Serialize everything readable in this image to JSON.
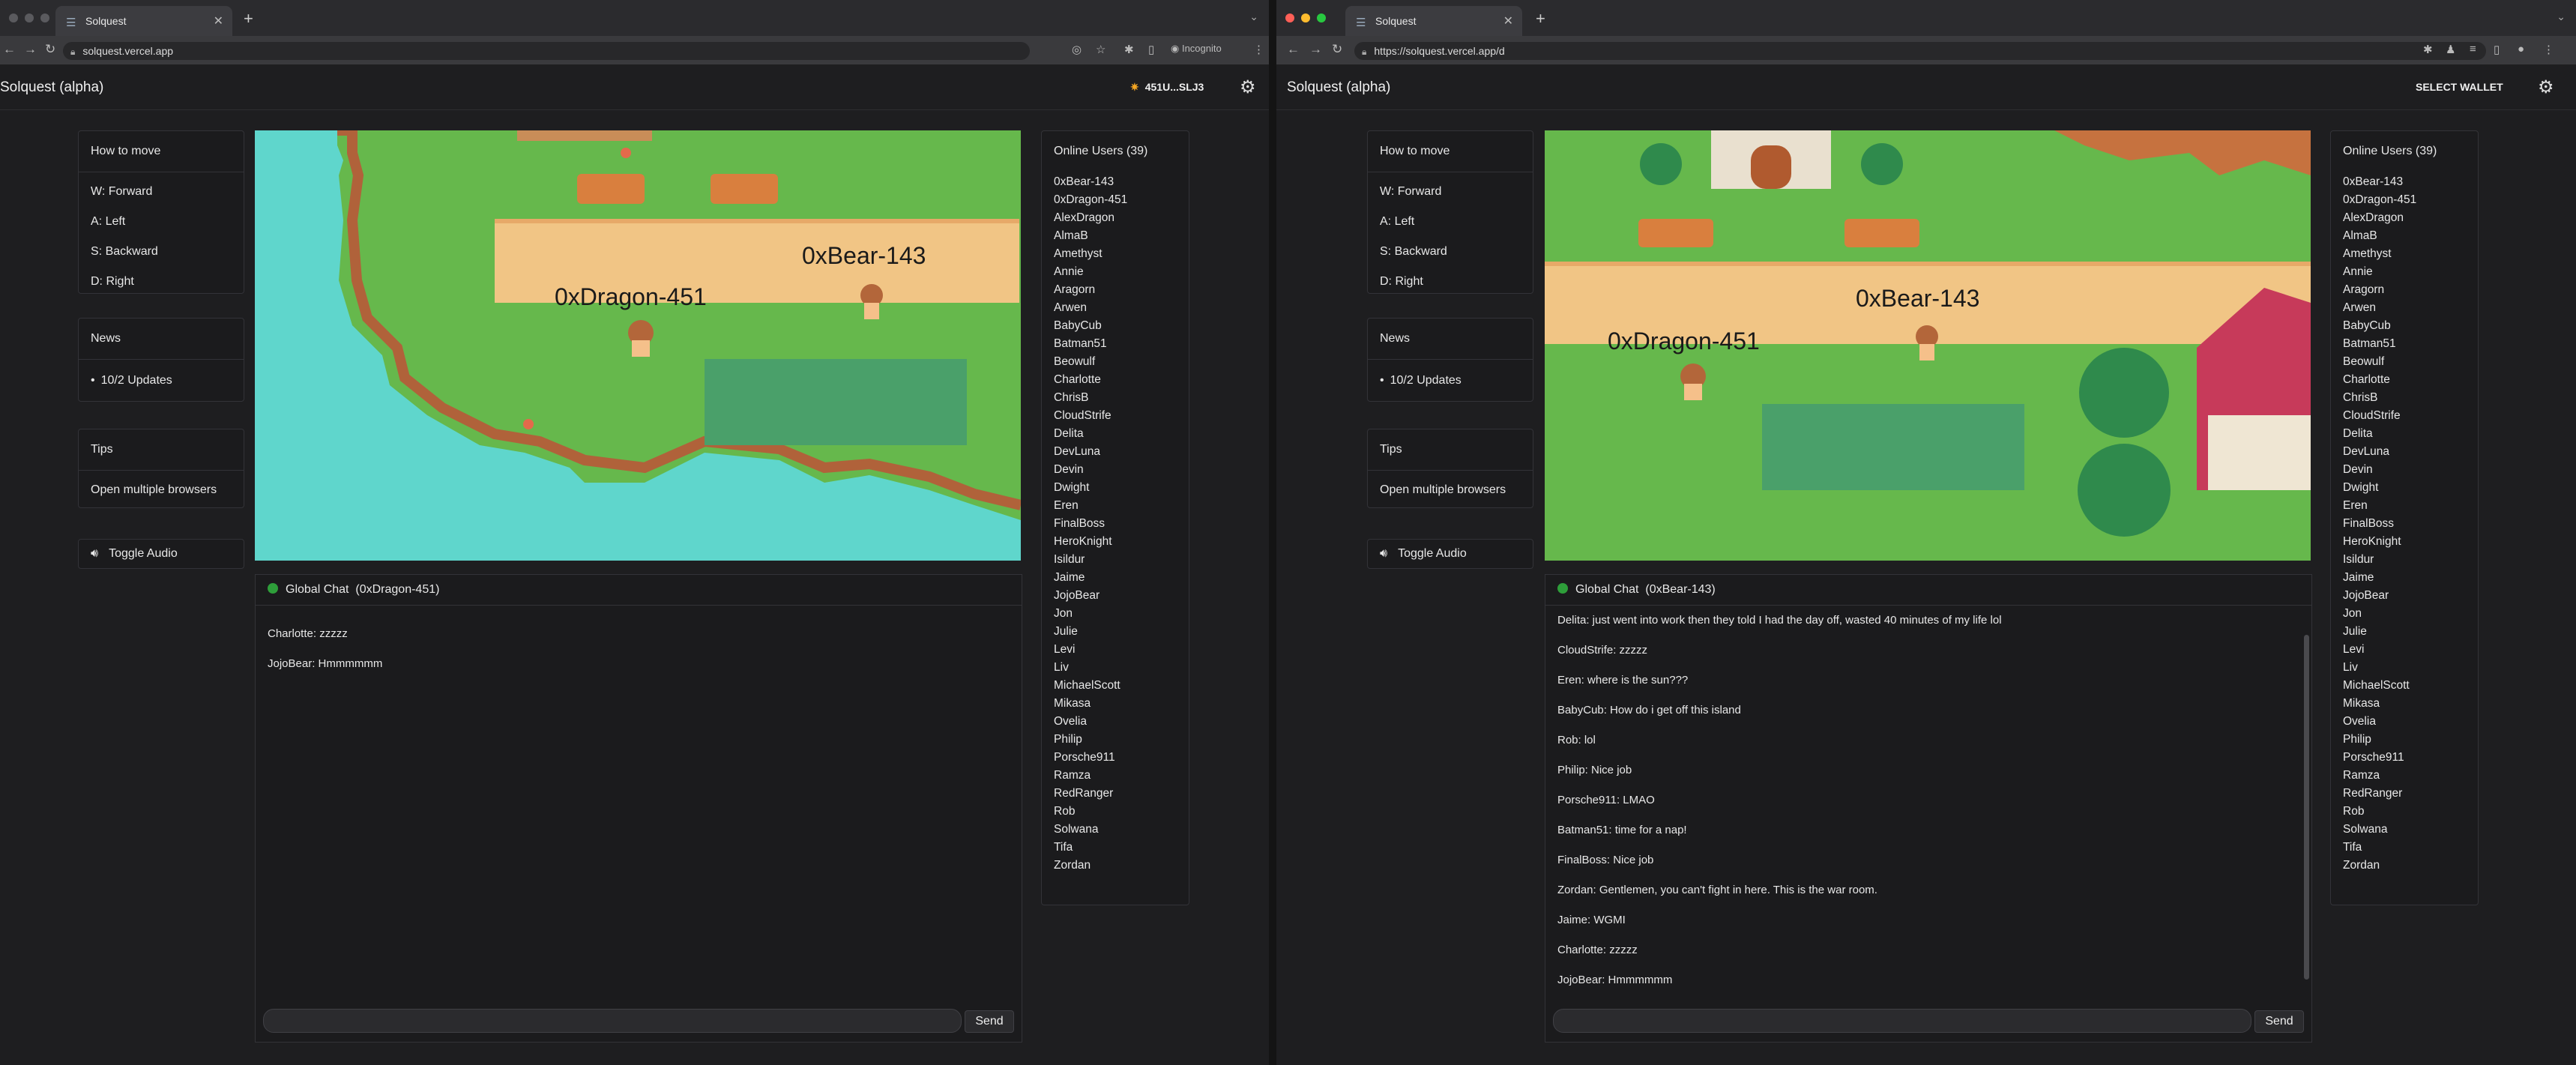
{
  "colors": {
    "close": "#ff5f57",
    "minimize": "#febc2e",
    "maximize": "#28c840",
    "online": "#2e9e3a",
    "water": "#5fd6cc",
    "grass": "#66b84c",
    "path": "#f1c585"
  },
  "left": {
    "tab_title": "Solquest",
    "url": "solquest.vercel.app",
    "incognito": "Incognito",
    "app_title": "Solquest (alpha)",
    "wallet": "451U...SLJ3",
    "how_to_move": {
      "title": "How to move",
      "items": [
        "W: Forward",
        "A: Left",
        "S: Backward",
        "D: Right"
      ]
    },
    "news": {
      "title": "News",
      "items": [
        "10/2 Updates"
      ]
    },
    "tips": {
      "title": "Tips",
      "items": [
        "Open multiple browsers"
      ]
    },
    "audio_label": "Toggle Audio",
    "game_labels": [
      "0xDragon-451",
      "0xBear-143"
    ],
    "chat": {
      "title": "Global Chat  (0xDragon-451)",
      "messages": [
        "Charlotte: zzzzz",
        "JojoBear: Hmmmmmm"
      ],
      "input_value": "",
      "send_label": "Send"
    },
    "users_title": "Online Users (39)"
  },
  "right": {
    "tab_title": "Solquest",
    "url": "https://solquest.vercel.app/d",
    "app_title": "Solquest (alpha)",
    "wallet": "SELECT WALLET",
    "how_to_move": {
      "title": "How to move",
      "items": [
        "W: Forward",
        "A: Left",
        "S: Backward",
        "D: Right"
      ]
    },
    "news": {
      "title": "News",
      "items": [
        "10/2 Updates"
      ]
    },
    "tips": {
      "title": "Tips",
      "items": [
        "Open multiple browsers"
      ]
    },
    "audio_label": "Toggle Audio",
    "game_labels": [
      "0xBear-143",
      "0xDragon-451"
    ],
    "chat": {
      "title": "Global Chat  (0xBear-143)",
      "messages": [
        "Delita: just went into work then they told I had the day off, wasted 40 minutes of my life lol",
        "CloudStrife: zzzzz",
        "Eren: where is the sun???",
        "BabyCub: How do i get off this island",
        "Rob: lol",
        "Philip: Nice job",
        "Porsche911: LMAO",
        "Batman51: time for a nap!",
        "FinalBoss: Nice job",
        "Zordan: Gentlemen, you can't fight in here. This is the war room.",
        "Jaime: WGMI",
        "Charlotte: zzzzz",
        "JojoBear: Hmmmmmm"
      ],
      "input_value": "",
      "send_label": "Send"
    },
    "users_title": "Online Users (39)"
  },
  "users": [
    "0xBear-143",
    "0xDragon-451",
    "AlexDragon",
    "AlmaB",
    "Amethyst",
    "Annie",
    "Aragorn",
    "Arwen",
    "BabyCub",
    "Batman51",
    "Beowulf",
    "Charlotte",
    "ChrisB",
    "CloudStrife",
    "Delita",
    "DevLuna",
    "Devin",
    "Dwight",
    "Eren",
    "FinalBoss",
    "HeroKnight",
    "Isildur",
    "Jaime",
    "JojoBear",
    "Jon",
    "Julie",
    "Levi",
    "Liv",
    "MichaelScott",
    "Mikasa",
    "Ovelia",
    "Philip",
    "Porsche911",
    "Ramza",
    "RedRanger",
    "Rob",
    "Solwana",
    "Tifa",
    "Zordan"
  ]
}
